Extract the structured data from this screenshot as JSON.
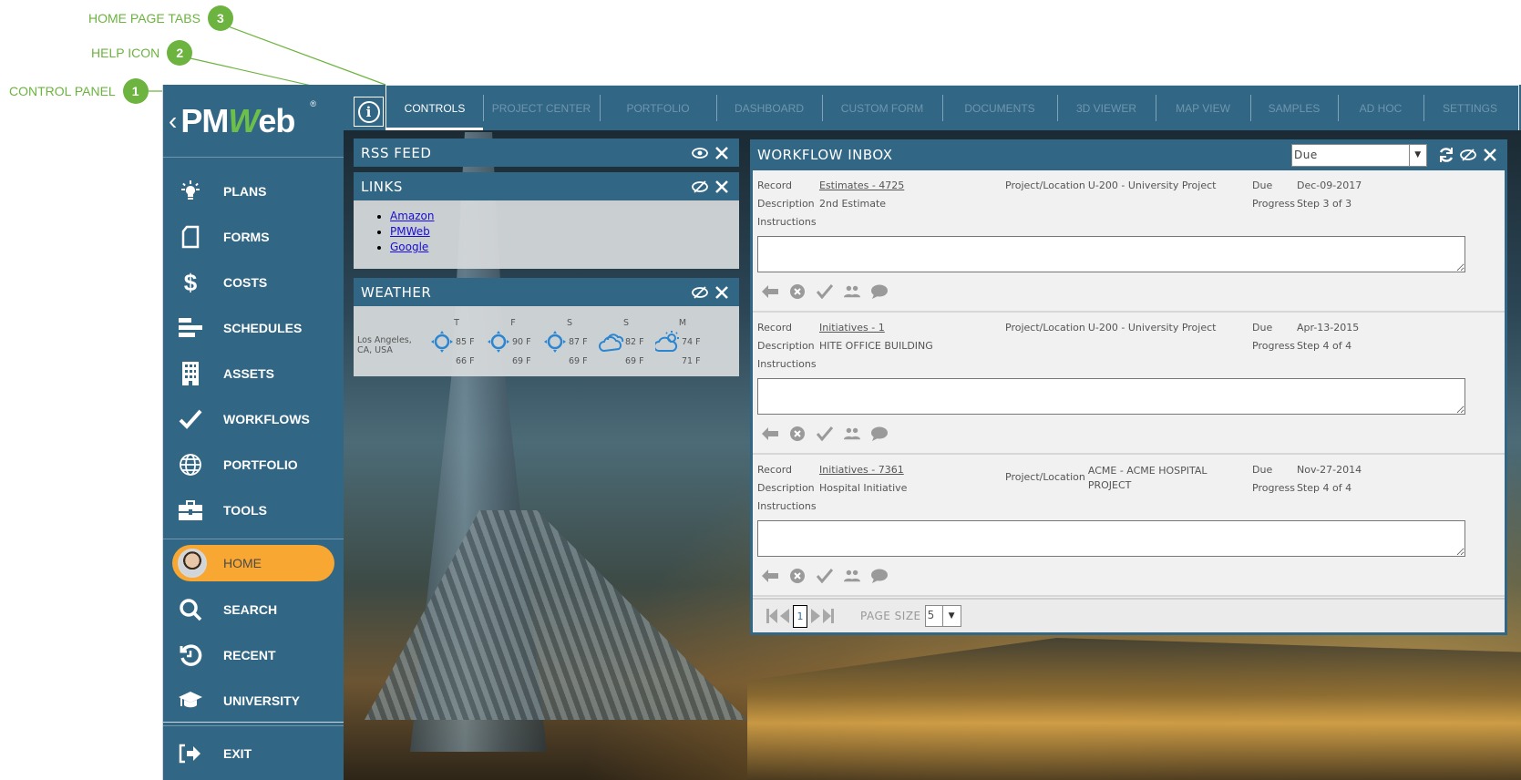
{
  "callouts": [
    {
      "num": "1",
      "label": "CONTROL PANEL"
    },
    {
      "num": "2",
      "label": "HELP ICON"
    },
    {
      "num": "3",
      "label": "HOME PAGE TABS"
    }
  ],
  "brand": {
    "back": "‹",
    "name_a": "PM",
    "name_w": "W",
    "name_b": "eb",
    "reg": "®"
  },
  "colors": {
    "primary": "#316685",
    "accent": "#f8a832",
    "callout": "#6cb33f"
  },
  "sidebar": {
    "items": [
      {
        "label": "PLANS",
        "icon": "lightbulb-icon"
      },
      {
        "label": "FORMS",
        "icon": "document-icon"
      },
      {
        "label": "COSTS",
        "icon": "dollar-icon"
      },
      {
        "label": "SCHEDULES",
        "icon": "schedule-bars-icon"
      },
      {
        "label": "ASSETS",
        "icon": "building-icon"
      },
      {
        "label": "WORKFLOWS",
        "icon": "checkmark-icon"
      },
      {
        "label": "PORTFOLIO",
        "icon": "globe-icon"
      },
      {
        "label": "TOOLS",
        "icon": "toolbox-icon"
      }
    ],
    "home": {
      "label": "HOME"
    },
    "items2": [
      {
        "label": "SEARCH",
        "icon": "search-icon"
      },
      {
        "label": "RECENT",
        "icon": "history-icon"
      },
      {
        "label": "UNIVERSITY",
        "icon": "graduation-cap-icon"
      }
    ],
    "exit": {
      "label": "EXIT",
      "icon": "exit-icon"
    }
  },
  "help": {
    "glyph": "i"
  },
  "tabs": [
    {
      "label": "CONTROLS",
      "active": true
    },
    {
      "label": "PROJECT CENTER"
    },
    {
      "label": "PORTFOLIO"
    },
    {
      "label": "DASHBOARD"
    },
    {
      "label": "CUSTOM FORM"
    },
    {
      "label": "DOCUMENTS"
    },
    {
      "label": "3D VIEWER"
    },
    {
      "label": "MAP VIEW"
    },
    {
      "label": "SAMPLES"
    },
    {
      "label": "AD HOC"
    },
    {
      "label": "SETTINGS"
    }
  ],
  "widgets": {
    "rss": {
      "title": "RSS FEED"
    },
    "links": {
      "title": "LINKS",
      "items": [
        "Amazon",
        "PMWeb",
        "Google"
      ]
    },
    "weather": {
      "title": "WEATHER",
      "location": "Los Angeles, CA, USA",
      "days": [
        {
          "day": "T",
          "icon": "sun-icon",
          "high": "85 F",
          "low": "66 F"
        },
        {
          "day": "F",
          "icon": "sun-icon",
          "high": "90 F",
          "low": "69 F"
        },
        {
          "day": "S",
          "icon": "sun-icon",
          "high": "87 F",
          "low": "69 F"
        },
        {
          "day": "S",
          "icon": "cloud-icon",
          "high": "82 F",
          "low": "69 F"
        },
        {
          "day": "M",
          "icon": "partly-cloudy-icon",
          "high": "74 F",
          "low": "71 F"
        }
      ]
    }
  },
  "inbox": {
    "title": "WORKFLOW INBOX",
    "filter": "Due",
    "labels": {
      "record": "Record",
      "description": "Description",
      "instructions": "Instructions",
      "project": "Project/Location",
      "due": "Due",
      "progress": "Progress"
    },
    "items": [
      {
        "record": "Estimates - 4725",
        "description": "2nd Estimate",
        "project": "U-200 - University Project",
        "due": "Dec-09-2017",
        "progress": "Step 3 of 3"
      },
      {
        "record": "Initiatives - 1",
        "description": "HITE OFFICE BUILDING",
        "project": "U-200 - University Project",
        "due": "Apr-13-2015",
        "progress": "Step 4 of 4"
      },
      {
        "record": "Initiatives - 7361",
        "description": "Hospital Initiative",
        "project": "ACME - ACME HOSPITAL PROJECT",
        "due": "Nov-27-2014",
        "progress": "Step 4 of 4"
      }
    ],
    "pager": {
      "page": "1",
      "page_size_label": "PAGE SIZE",
      "page_size": "5"
    }
  }
}
